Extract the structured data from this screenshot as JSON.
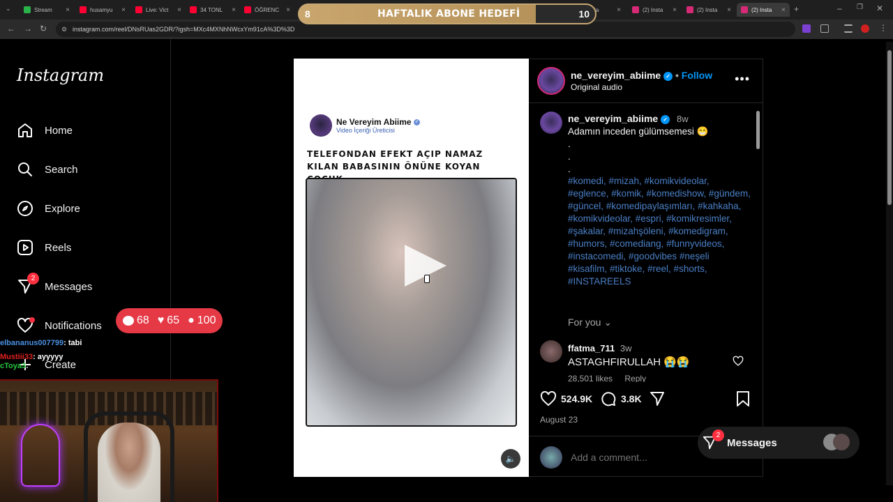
{
  "browser": {
    "tabs": [
      {
        "label": "Stream",
        "color": "#29b34a"
      },
      {
        "label": "husamyu",
        "color": "#ff0033"
      },
      {
        "label": "Live: Vict",
        "color": "#ff0033"
      },
      {
        "label": "34 TONL",
        "color": "#ff0033"
      },
      {
        "label": "ÖĞRENC",
        "color": "#ff0033"
      },
      {
        "label": "Insta",
        "color": "#d62976"
      },
      {
        "label": "Insta",
        "color": "#d62976"
      },
      {
        "label": "(2) Insta",
        "color": "#d62976"
      },
      {
        "label": "(2) Insta",
        "color": "#d62976"
      },
      {
        "label": "(2) Insta",
        "color": "#d62976"
      },
      {
        "label": "(2) Insta",
        "color": "#d62976"
      }
    ],
    "url": "instagram.com/reel/DNsRUas2GDR/?igsh=MXc4MXNhNWcxYm91cA%3D%3D"
  },
  "overlay": {
    "sub_goal_current": "8",
    "sub_goal_label": "HAFTALIK ABONE HEDEFİ",
    "sub_goal_target": "10",
    "stats_comments": "68",
    "stats_likes": "65",
    "stats_viewers": "100",
    "chat": [
      {
        "user": "elbananus007799",
        "msg": ": tabi",
        "color": "#4a90e2"
      },
      {
        "user": "Mustiii33",
        "msg": ": ayyyyy",
        "color": "#e02020"
      },
      {
        "user": "cToya3",
        "msg": ":",
        "color": "#27c93f"
      }
    ]
  },
  "sidebar": {
    "logo": "Instagram",
    "items": [
      {
        "label": "Home",
        "icon": "home-icon"
      },
      {
        "label": "Search",
        "icon": "search-icon"
      },
      {
        "label": "Explore",
        "icon": "compass-icon"
      },
      {
        "label": "Reels",
        "icon": "reels-icon"
      },
      {
        "label": "Messages",
        "icon": "messenger-icon",
        "badge": "2"
      },
      {
        "label": "Notifications",
        "icon": "heart-icon"
      },
      {
        "label": "Create",
        "icon": "plus-icon"
      }
    ]
  },
  "reel": {
    "account": "Ne Vereyim Abiime",
    "account_sub": "Video İçeriği Üreticisi",
    "caption": "TELEFONDAN EFEKT AÇIP NAMAZ KILAN BABASININ ÖNÜNE KOYAN ÇOCUK"
  },
  "post": {
    "username": "ne_vereyim_abiime",
    "follow_label": "Follow",
    "audio": "Original audio",
    "caption_time": "8w",
    "caption_text": "Adamın inceden gülümsemesi 😁",
    "caption_dots": ".\n.\n.",
    "hashtags": "#komedi, #mizah, #komikvideolar, #eglence, #komik, #komedishow, #gündem, #güncel, #komedipaylaşımları, #kahkaha, #komikvideolar, #espri, #komikresimler, #şakalar, #mizahşöleni, #komedigram, #humors, #comediang, #funnyvideos, #instacomedi, #goodvibes #neşeli #kisafilm, #tiktoke, #reel, #shorts, #INSTAREELS",
    "for_you": "For you",
    "comment": {
      "user": "ffatma_711",
      "time": "3w",
      "text": "ASTAGHFIRULLAH 😭😭",
      "likes": "28,501 likes",
      "reply": "Reply"
    },
    "likes": "524.9K",
    "comments_count": "3.8K",
    "date": "August 23",
    "add_comment_placeholder": "Add a comment..."
  },
  "messages_float": {
    "label": "Messages",
    "badge": "2"
  }
}
